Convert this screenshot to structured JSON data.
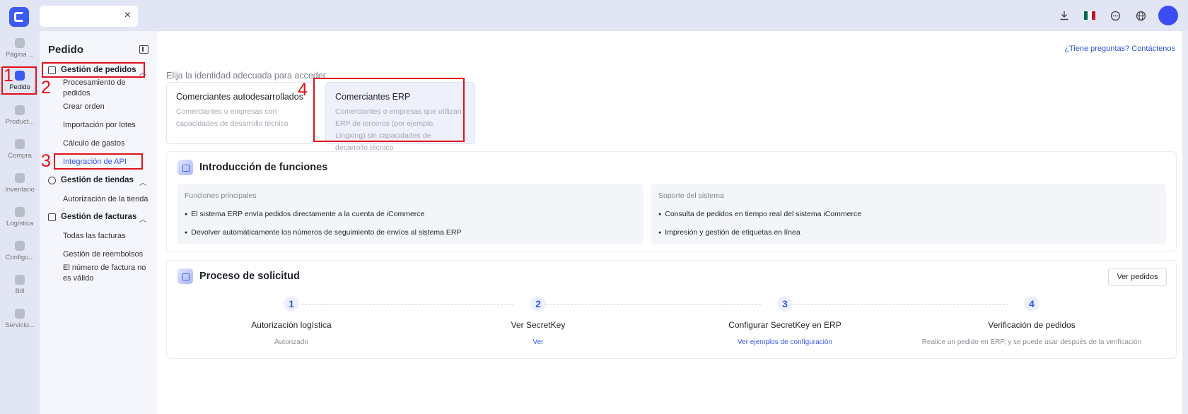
{
  "topbar": {
    "tab_close": "×",
    "icons": [
      "download-icon",
      "mexico-flag-icon",
      "chat-icon",
      "globe-icon",
      "avatar"
    ],
    "flag_colors": [
      "#006847",
      "#ffffff",
      "#ce1126"
    ]
  },
  "rail": {
    "items": [
      {
        "label": "Página ...",
        "icon": "home-icon"
      },
      {
        "label": "Pedido",
        "icon": "order-icon"
      },
      {
        "label": "Product...",
        "icon": "product-icon"
      },
      {
        "label": "Compra",
        "icon": "purchase-icon"
      },
      {
        "label": "Inventario",
        "icon": "inventory-icon"
      },
      {
        "label": "Logística",
        "icon": "logistics-icon"
      },
      {
        "label": "Configu...",
        "icon": "settings-icon"
      },
      {
        "label": "Bill",
        "icon": "bill-icon"
      },
      {
        "label": "Servicio...",
        "icon": "service-icon"
      }
    ]
  },
  "menu": {
    "title": "Pedido",
    "groups": [
      {
        "label": "Gestión de pedidos",
        "items": [
          "Procesamiento de pedidos",
          "Crear orden",
          "Importación por lotes",
          "Cálculo de gastos",
          "Integración de API"
        ]
      },
      {
        "label": "Gestión de tiendas",
        "items": [
          "Autorización de la tienda"
        ]
      },
      {
        "label": "Gestión de facturas",
        "items": [
          "Todas las facturas",
          "Gestión de reembolsos",
          "El número de factura no es válido"
        ]
      }
    ]
  },
  "main": {
    "help_link": "¿Tiene preguntas? Contáctenos",
    "section_label": "Elija la identidad adecuada para acceder",
    "cards": [
      {
        "title": "Comerciantes autodesarrollados",
        "desc": "Comerciantes o empresas con capacidades de desarrollo técnico"
      },
      {
        "title": "Comerciantes ERP",
        "desc": "Comerciantes o empresas que utilizan ERP de terceros (por ejemplo, Lingxing) sin capacidades de desarrollo técnico"
      }
    ],
    "intro": {
      "title": "Introducción de funciones",
      "main_title": "Funciones principales",
      "main_items": [
        "El sistema ERP envía pedidos directamente a la cuenta de iCommerce",
        "Devolver automáticamente los números de seguimiento de envíos al sistema ERP"
      ],
      "support_title": "Soporte del sistema",
      "support_items": [
        "Consulta de pedidos en tiempo real del sistema iCommerce",
        "Impresión y gestión de etiquetas en línea"
      ]
    },
    "process": {
      "title": "Proceso de solicitud",
      "button": "Ver pedidos",
      "steps": [
        {
          "num": "1",
          "title": "Autorización logística",
          "sub": "Autorizado"
        },
        {
          "num": "2",
          "title": "Ver SecretKey",
          "sub": "Ver"
        },
        {
          "num": "3",
          "title": "Configurar SecretKey en ERP",
          "sub": "Ver ejemplos de configuración"
        },
        {
          "num": "4",
          "title": "Verificación de pedidos",
          "sub": "Realice un pedido en ERP, y se puede usar después de la verificación"
        }
      ]
    }
  },
  "annotations": [
    "1",
    "2",
    "3",
    "4"
  ],
  "colors": {
    "accent": "#3554f2",
    "annotation": "#e0121c"
  }
}
